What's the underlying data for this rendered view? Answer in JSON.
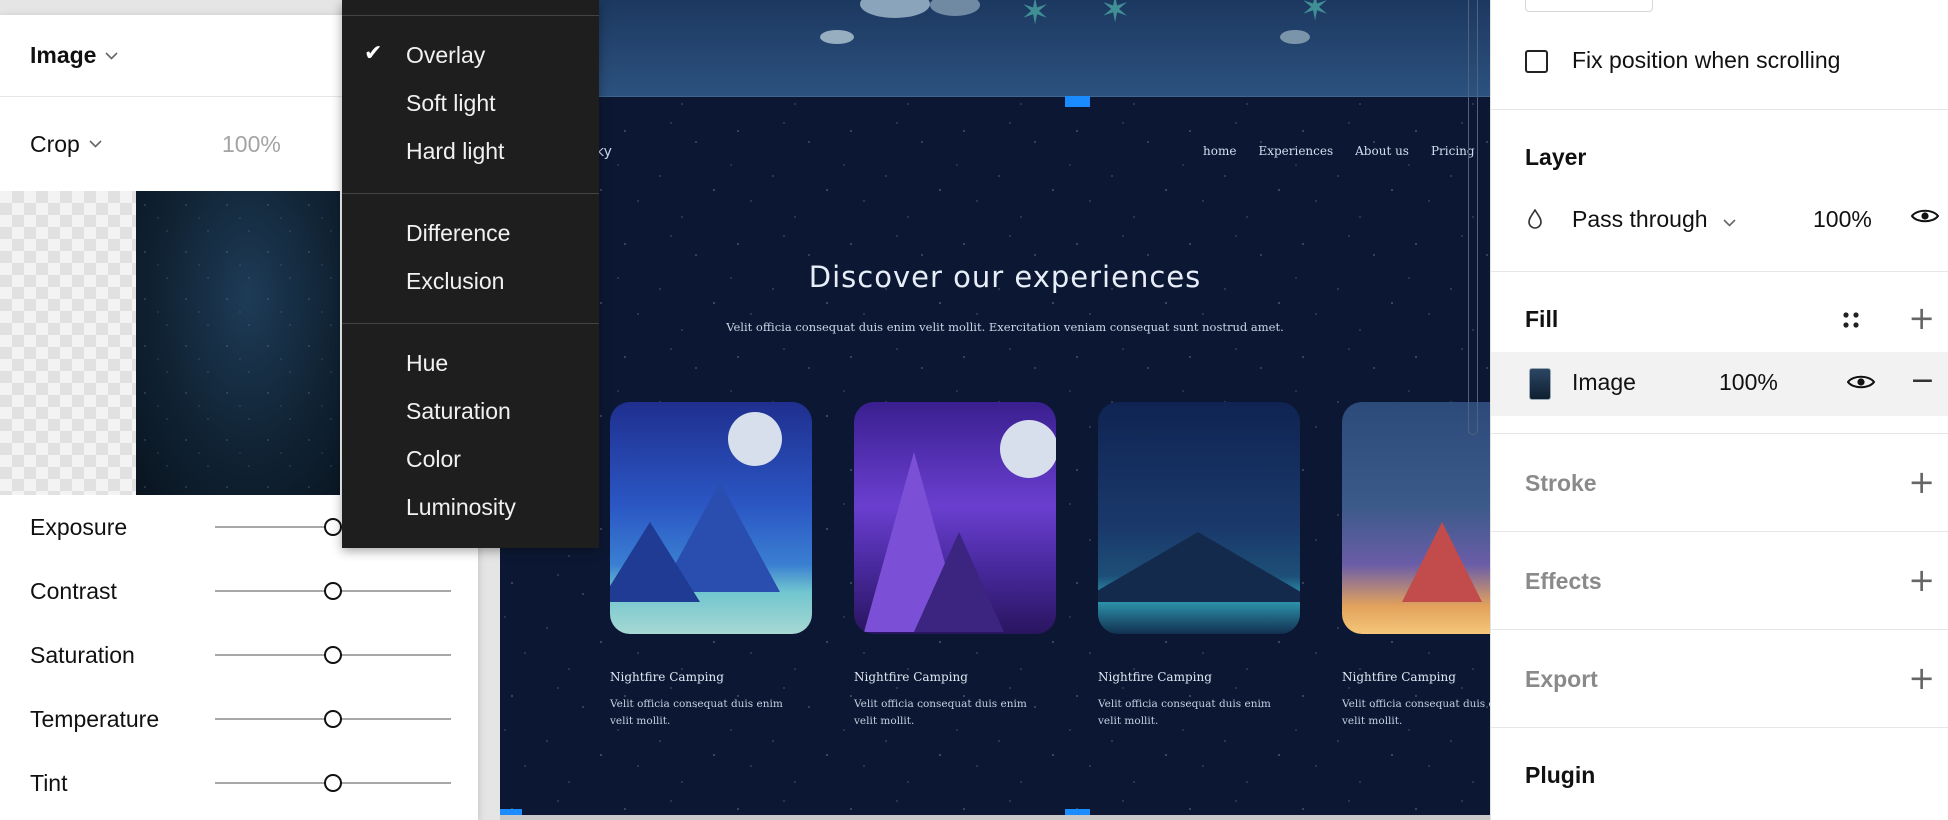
{
  "image_panel": {
    "title": "Image",
    "crop": {
      "label": "Crop",
      "value": "100%"
    },
    "adjustments": [
      {
        "label": "Exposure",
        "value": 0.5
      },
      {
        "label": "Contrast",
        "value": 0.5
      },
      {
        "label": "Saturation",
        "value": 0.5
      },
      {
        "label": "Temperature",
        "value": 0.5
      },
      {
        "label": "Tint",
        "value": 0.5
      }
    ]
  },
  "blend_menu": {
    "selected": "Overlay",
    "groups": [
      [
        "Overlay",
        "Soft light",
        "Hard light"
      ],
      [
        "Difference",
        "Exclusion"
      ],
      [
        "Hue",
        "Saturation",
        "Color",
        "Luminosity"
      ]
    ]
  },
  "canvas": {
    "site_logo": "ky",
    "nav": [
      "home",
      "Experiences",
      "About us",
      "Pricing"
    ],
    "heading": "Discover our experiences",
    "subheading": "Velit officia consequat duis enim velit mollit. Exercitation veniam consequat sunt nostrud amet.",
    "cards": [
      {
        "title": "Nightfire Camping",
        "desc": "Velit officia consequat duis enim velit mollit."
      },
      {
        "title": "Nightfire Camping",
        "desc": "Velit officia consequat duis enim velit mollit."
      },
      {
        "title": "Nightfire Camping",
        "desc": "Velit officia consequat duis enim velit mollit."
      },
      {
        "title": "Nightfire Camping",
        "desc": "Velit officia consequat duis enim velit mollit."
      }
    ]
  },
  "properties": {
    "fix_position_label": "Fix position when scrolling",
    "fix_position_checked": false,
    "layer": {
      "title": "Layer",
      "blend": "Pass through",
      "opacity": "100%"
    },
    "fill": {
      "title": "Fill",
      "item_label": "Image",
      "opacity": "100%"
    },
    "stroke": {
      "title": "Stroke"
    },
    "effects": {
      "title": "Effects"
    },
    "export": {
      "title": "Export"
    },
    "plugin": {
      "title": "Plugin"
    }
  },
  "colors": {
    "accent": "#1a8cff",
    "menu_bg": "#1e1e1e",
    "canvas_bg": "#0c1833"
  },
  "icons": [
    "check-icon",
    "chevron-down-icon",
    "droplet-icon",
    "eye-icon",
    "grid-dots-icon",
    "plus-icon",
    "minus-icon"
  ]
}
